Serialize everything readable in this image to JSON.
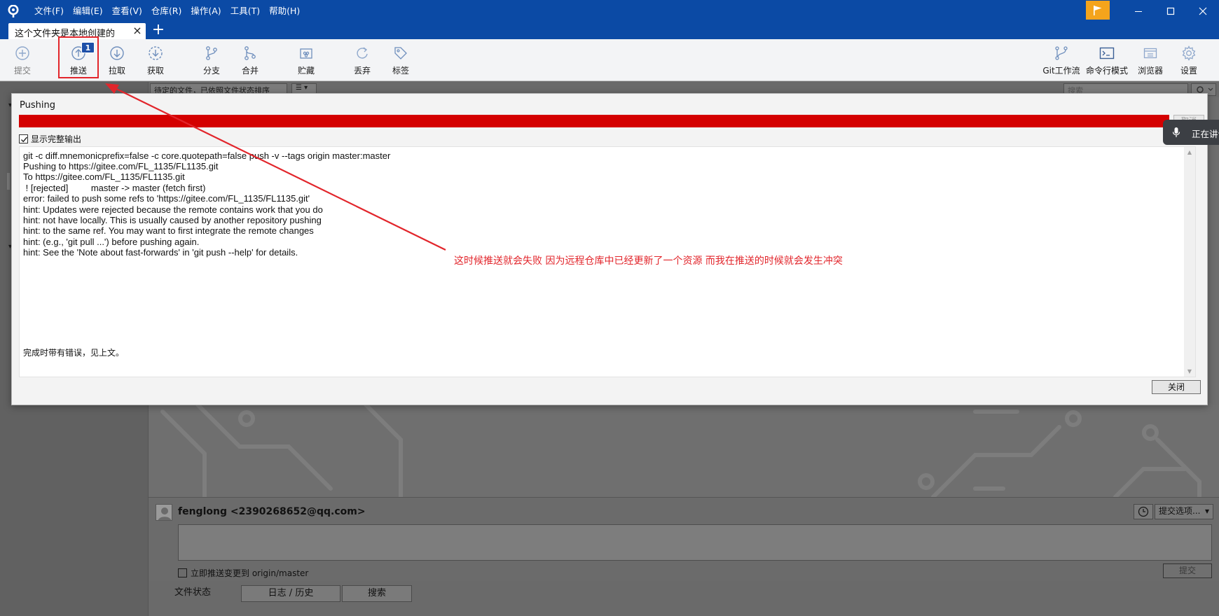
{
  "colors": {
    "title_bar": "#0b4aa5",
    "progress_error": "#d40000",
    "annotation": "#e2252b",
    "badge": "#1d4fa8",
    "flag": "#f4a41c"
  },
  "menu": [
    "文件(F)",
    "编辑(E)",
    "查看(V)",
    "仓库(R)",
    "操作(A)",
    "工具(T)",
    "帮助(H)"
  ],
  "tab": {
    "title": "这个文件夹是本地创建的"
  },
  "toolbar": {
    "commit": "提交",
    "push": "推送",
    "push_badge": "1",
    "pull": "拉取",
    "fetch": "获取",
    "branch": "分支",
    "merge": "合并",
    "stash": "贮藏",
    "discard": "丢弃",
    "tag": "标签",
    "git_flow": "Git工作流",
    "terminal": "命令行模式",
    "browser": "浏览器",
    "settings": "设置"
  },
  "filter": {
    "label": "待定的文件，已依照文件状态排序",
    "search_placeholder": "搜索"
  },
  "dialog": {
    "title": "Pushing",
    "cancel": "取消",
    "show_full_output": "显示完整输出",
    "output_lines": [
      "git -c diff.mnemonicprefix=false -c core.quotepath=false push -v --tags origin master:master",
      "Pushing to https://gitee.com/FL_1135/FL1135.git",
      "To https://gitee.com/FL_1135/FL1135.git",
      " ! [rejected]         master -> master (fetch first)",
      "error: failed to push some refs to 'https://gitee.com/FL_1135/FL1135.git'",
      "hint: Updates were rejected because the remote contains work that you do",
      "hint: not have locally. This is usually caused by another repository pushing",
      "hint: to the same ref. You may want to first integrate the remote changes",
      "hint: (e.g., 'git pull ...') before pushing again.",
      "hint: See the 'Note about fast-forwards' in 'git push --help' for details."
    ],
    "done_message": "完成时带有错误，见上文。",
    "close": "关闭"
  },
  "annotation": "这时候推送就会失败  因为远程仓库中已经更新了一个资源  而我在推送的时候就会发生冲突",
  "voice_toast": "正在讲话",
  "commit_panel": {
    "author": "fenglong <2390268652@qq.com>",
    "options": "提交选项...",
    "push_immediately": "立即推送变更到 origin/master",
    "commit_button": "提交"
  },
  "bottom_tabs": [
    "文件状态",
    "日志 / 历史",
    "搜索"
  ]
}
